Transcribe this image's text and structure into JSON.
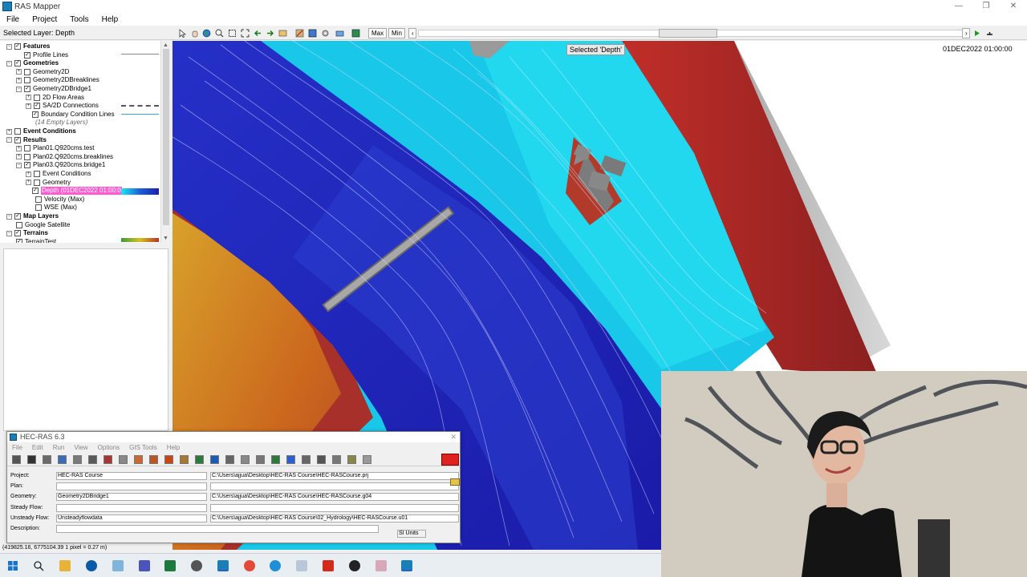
{
  "window": {
    "title": "RAS Mapper",
    "controls": [
      "—",
      "❐",
      "✕"
    ]
  },
  "menu": [
    "File",
    "Project",
    "Tools",
    "Help"
  ],
  "toolbar": {
    "selected_layer": "Selected Layer: Depth",
    "max_label": "Max",
    "min_label": "Min"
  },
  "tree": [
    {
      "label": "Features",
      "bold": true,
      "checked": true,
      "expand": "−"
    },
    {
      "label": "Profile Lines",
      "checked": true
    },
    {
      "label": "Geometries",
      "bold": true,
      "checked": true,
      "expand": "−"
    },
    {
      "label": "Geometry2D",
      "checked": false,
      "expand": "+"
    },
    {
      "label": "Geometry2DBreaklines",
      "checked": false,
      "expand": "+"
    },
    {
      "label": "Geometry2DBridge1",
      "checked": true,
      "expand": "−"
    },
    {
      "label": "2D Flow Areas",
      "checked": false,
      "expand": "+"
    },
    {
      "label": "SA/2D Connections",
      "checked": true,
      "expand": "+"
    },
    {
      "label": "Boundary Condition Lines",
      "checked": true
    },
    {
      "label": "(14 Empty Layers)",
      "italic": true
    },
    {
      "label": "Event Conditions",
      "bold": true,
      "checked": false,
      "expand": "+"
    },
    {
      "label": "Results",
      "bold": true,
      "checked": true,
      "expand": "−"
    },
    {
      "label": "Plan01.Q920cms.test",
      "checked": false,
      "expand": "+"
    },
    {
      "label": "Plan02.Q920cms.breaklines",
      "checked": false,
      "expand": "+"
    },
    {
      "label": "Plan03.Q920cms.bridge1",
      "checked": true,
      "expand": "−"
    },
    {
      "label": "Event Conditions",
      "checked": false,
      "expand": "+"
    },
    {
      "label": "Geometry",
      "checked": false,
      "expand": "+"
    },
    {
      "label": "Depth (01DEC2022 01:00:0",
      "checked": true,
      "highlight": true
    },
    {
      "label": "Velocity (Max)",
      "checked": false
    },
    {
      "label": "WSE (Max)",
      "checked": false
    },
    {
      "label": "Map Layers",
      "bold": true,
      "checked": true,
      "expand": "−"
    },
    {
      "label": "Google Satellite",
      "checked": false
    },
    {
      "label": "Terrains",
      "bold": true,
      "checked": true,
      "expand": "−"
    },
    {
      "label": "TerrainTest",
      "checked": true
    }
  ],
  "map": {
    "selected_badge": "Selected 'Depth'",
    "timestamp": "01DEC2022 01:00:00"
  },
  "status": {
    "coords": "(419825.16, 6775104.39 1 pixel = 0.27 m)"
  },
  "hecras": {
    "title": "HEC-RAS 6.3",
    "menu": [
      "File",
      "Edit",
      "Run",
      "View",
      "Options",
      "GIS Tools",
      "Help"
    ],
    "fields": [
      {
        "label": "Project:",
        "value": "HEC-RAS Course",
        "path": "C:\\Users\\ajjua\\Desktop\\HEC-RAS Course\\HEC-RASCourse.prj"
      },
      {
        "label": "Plan:",
        "value": "",
        "path": ""
      },
      {
        "label": "Geometry:",
        "value": "Geometry2DBridge1",
        "path": "C:\\Users\\ajjua\\Desktop\\HEC-RAS Course\\HEC-RASCourse.g04"
      },
      {
        "label": "Steady Flow:",
        "value": "",
        "path": ""
      },
      {
        "label": "Unsteady Flow:",
        "value": "Unsteadyflowdata",
        "path": "C:\\Users\\ajjua\\Desktop\\HEC-RAS Course\\02_Hydrology\\HEC-RASCourse.u01"
      },
      {
        "label": "Description:",
        "value": "",
        "path": ""
      }
    ],
    "units": "SI Units"
  },
  "colors": {
    "deep": "#1a1fb0",
    "mid": "#2a6ad8",
    "shallow": "#19c8e8",
    "dry_red": "#b8322a",
    "terrain_orange": "#d27a1e"
  }
}
